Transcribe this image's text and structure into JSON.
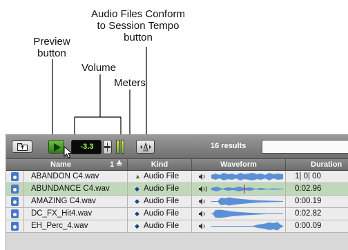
{
  "annotations": {
    "preview": "Preview\nbutton",
    "volume": "Volume",
    "meters": "Meters",
    "conform": "Audio Files Conform\nto Session Tempo\nbutton"
  },
  "toolbar": {
    "volume_value": "-3.3",
    "results": "16 results",
    "icons": [
      "folder-up-icon",
      "play-icon",
      "tempo-conform-icon"
    ]
  },
  "columns": {
    "name": "Name",
    "sort": "1",
    "kind": "Kind",
    "waveform": "Waveform",
    "duration": "Duration"
  },
  "colors": {
    "waveform": "#5b8fd6",
    "selected_row": "#bfd9b8",
    "playhead": "#c03020",
    "meter": "#a8d43a"
  },
  "rows": [
    {
      "name": "ABANDON C4.wav",
      "kind": "Audio File",
      "kind_icon": "audio-file-green-icon",
      "duration": "1| 0| 00"
    },
    {
      "name": "ABUNDANCE C4.wav",
      "kind": "Audio File",
      "kind_icon": "audio-file-icon",
      "duration": "0:02.96"
    },
    {
      "name": "AMAZING C4.wav",
      "kind": "Audio File",
      "kind_icon": "audio-file-icon",
      "duration": "0:00.19"
    },
    {
      "name": "DC_FX_Hit4.wav",
      "kind": "Audio File",
      "kind_icon": "audio-file-icon",
      "duration": "0:02.82"
    },
    {
      "name": "EH_Perc_4.wav",
      "kind": "Audio File",
      "kind_icon": "audio-file-icon",
      "duration": "0:00.09"
    }
  ]
}
